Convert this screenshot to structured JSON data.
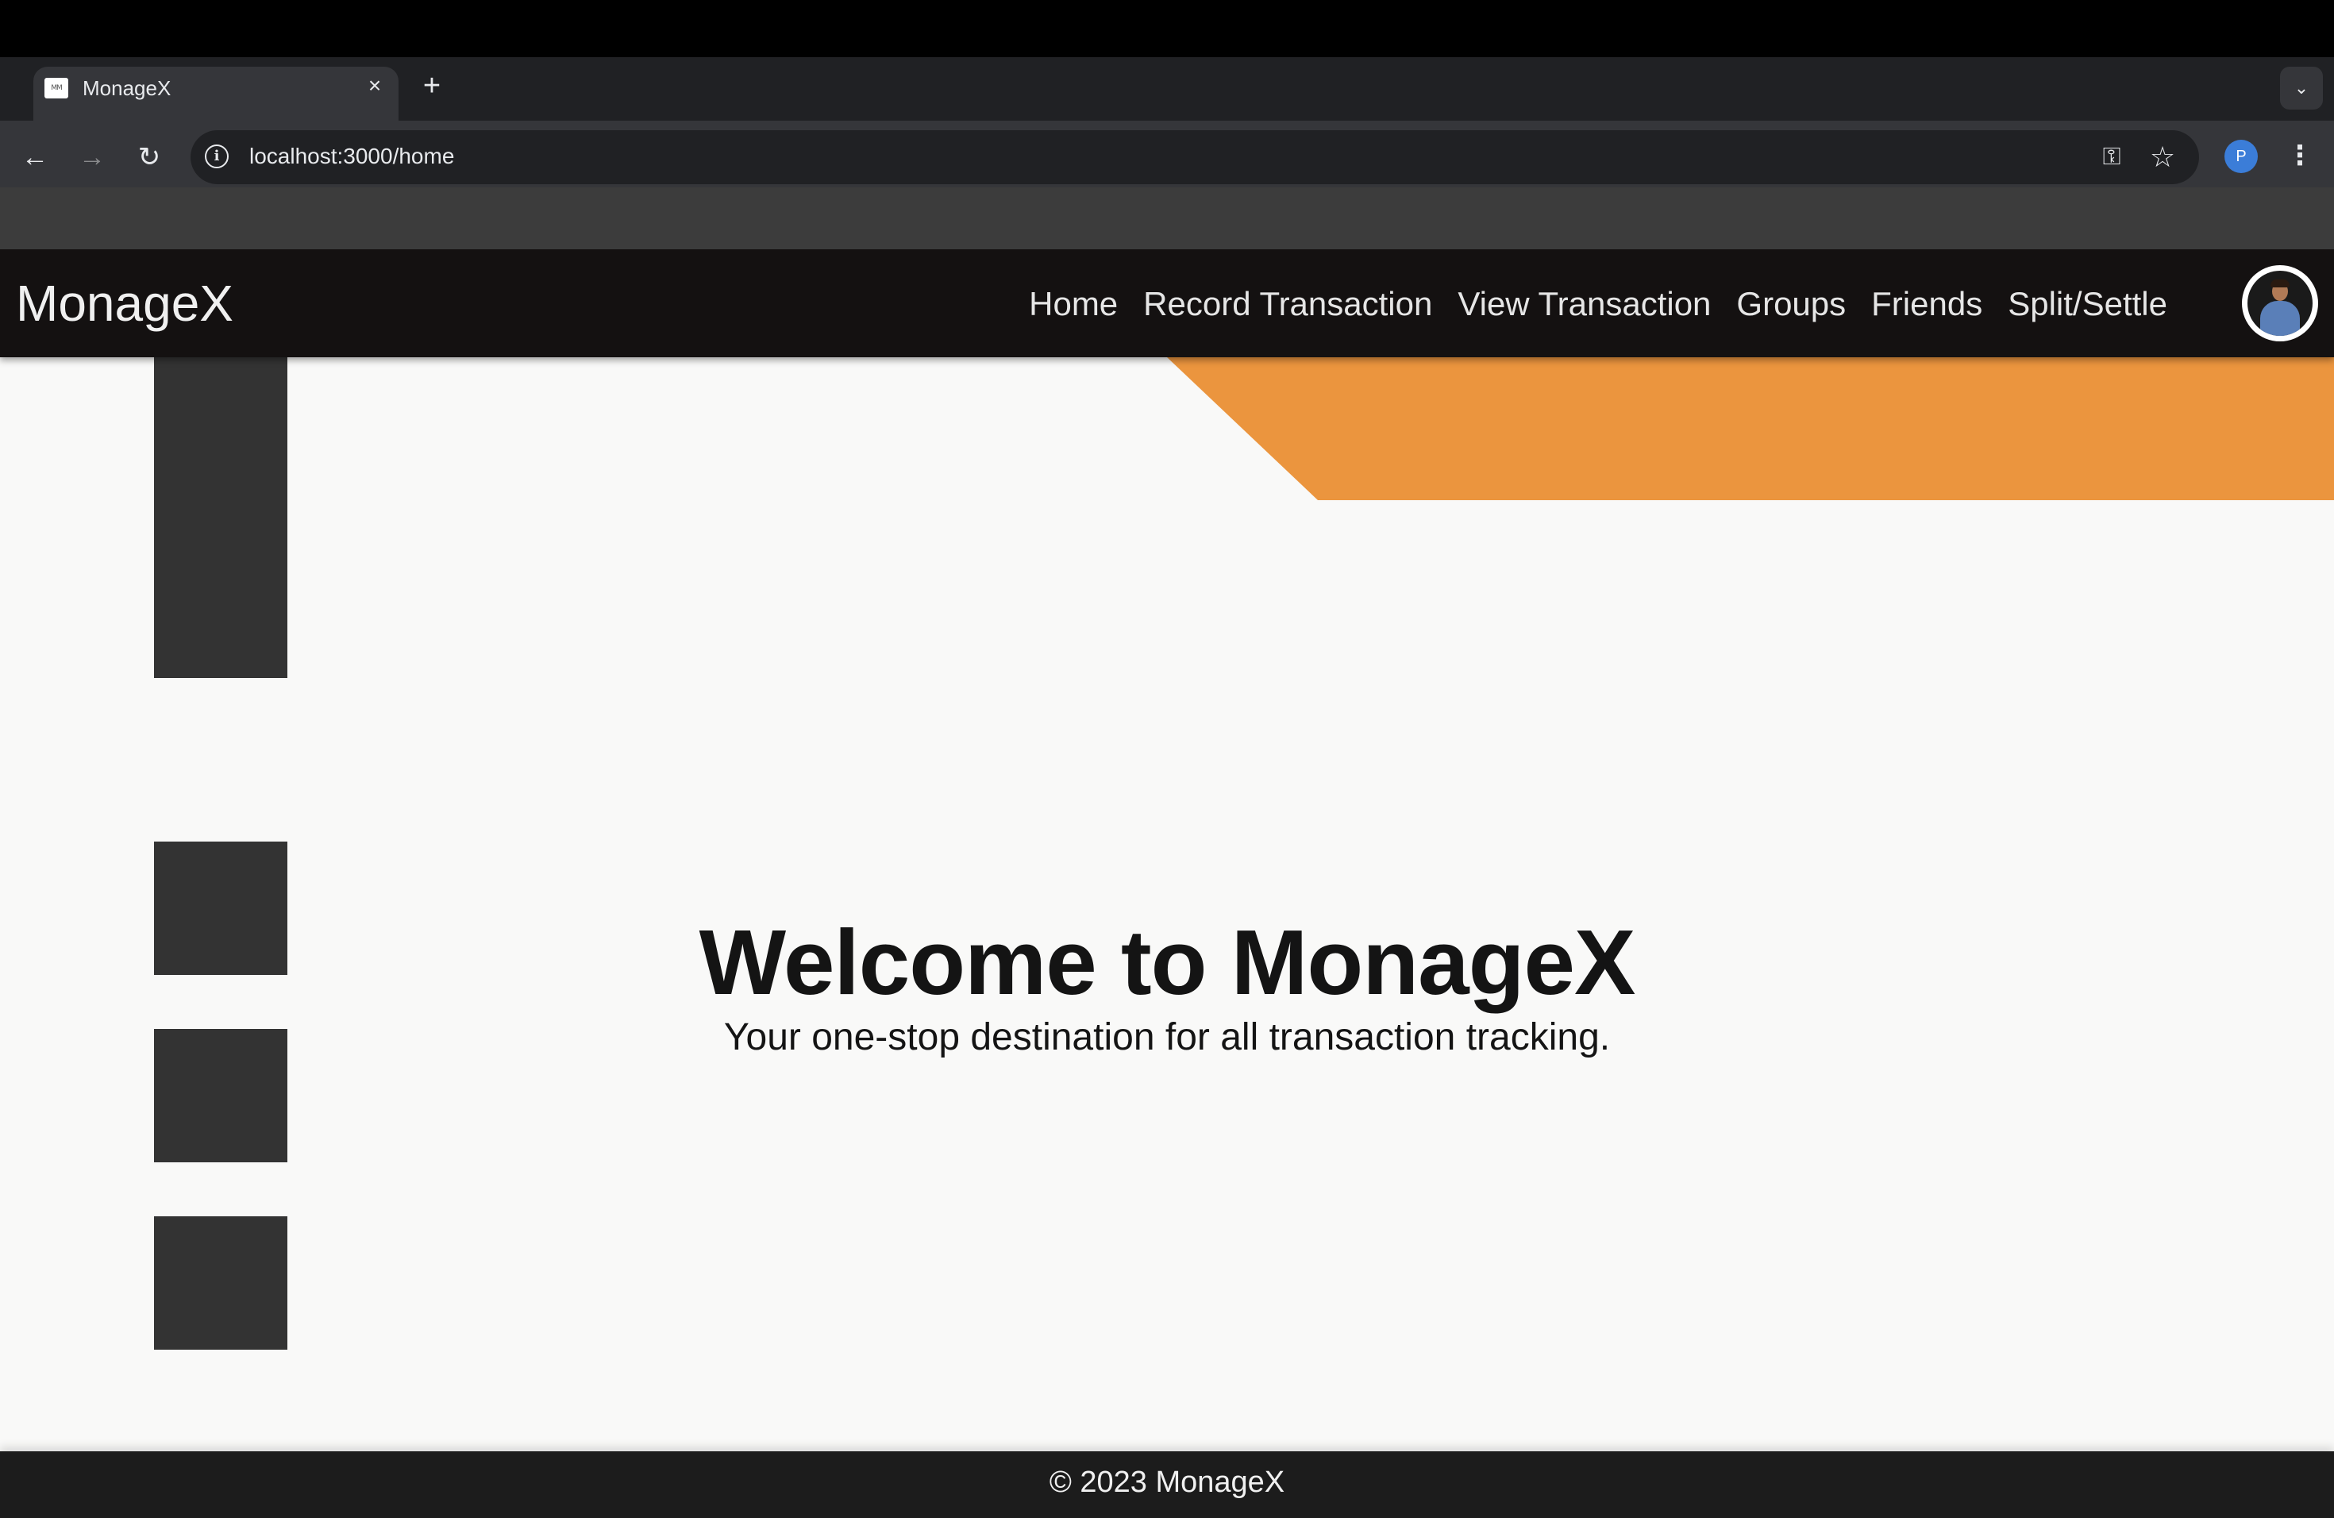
{
  "browser": {
    "tab": {
      "title": "MonageX",
      "favicon_text": "MM"
    },
    "url": "localhost:3000/home",
    "profile_initial": "P",
    "icons": {
      "close": "close-icon",
      "new_tab": "plus-icon",
      "back": "arrow-left-icon",
      "forward": "arrow-right-icon",
      "reload": "reload-icon",
      "info": "info-icon",
      "key": "key-icon",
      "star": "star-icon",
      "menu": "kebab-menu-icon",
      "tab_search": "chevron-down-icon"
    }
  },
  "navbar": {
    "brand": "MonageX",
    "links": [
      {
        "label": "Home"
      },
      {
        "label": "Record Transaction"
      },
      {
        "label": "View Transaction"
      },
      {
        "label": "Groups"
      },
      {
        "label": "Friends"
      },
      {
        "label": "Split/Settle"
      }
    ]
  },
  "hero": {
    "title": "Welcome to MonageX",
    "subtitle": "Your one-stop destination for all transaction tracking."
  },
  "footer": {
    "text": "© 2023 MonageX"
  },
  "colors": {
    "accent_orange": "#eb953e",
    "navbar_bg": "#141111",
    "block_gray": "#333333",
    "page_bg": "#f9f9f8"
  }
}
